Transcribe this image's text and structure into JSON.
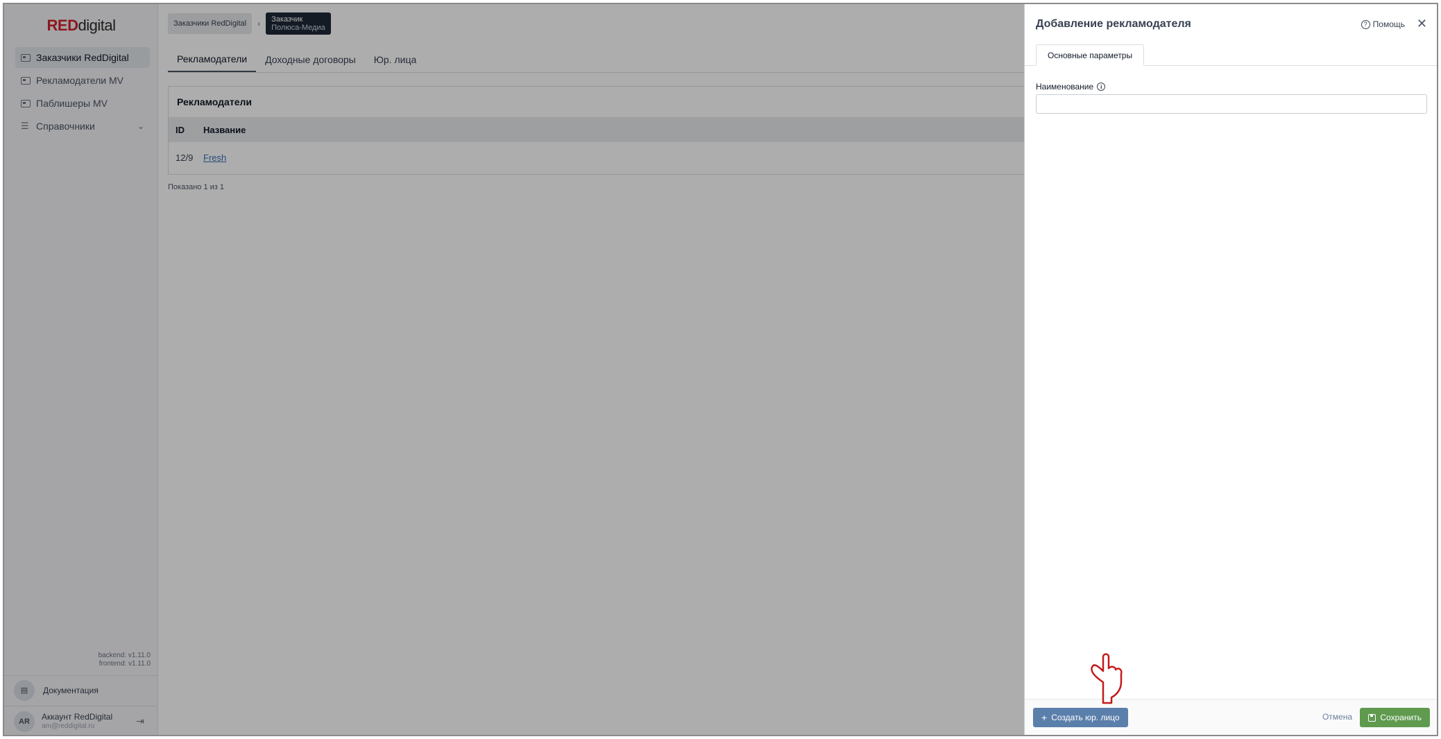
{
  "logo": {
    "red": "RED",
    "rest": "digital"
  },
  "sidebar": {
    "items": [
      {
        "label": "Заказчики RedDigital",
        "icon": "card-icon",
        "active": true
      },
      {
        "label": "Рекламодатели MV",
        "icon": "card-icon",
        "active": false
      },
      {
        "label": "Паблишеры MV",
        "icon": "card-icon",
        "active": false
      },
      {
        "label": "Справочники",
        "icon": "list-icon",
        "active": false
      }
    ],
    "versions": {
      "backend": "backend: v1.11.0",
      "frontend": "frontend: v1.11.0"
    },
    "docs_label": "Документация",
    "account": {
      "initials": "AR",
      "name": "Аккаунт RedDigital",
      "email": "am@reddigital.ru"
    }
  },
  "breadcrumbs": {
    "first": "Заказчики RedDigital",
    "current_title": "Заказчик",
    "current_sub": "Полюса-Медиа"
  },
  "tabs": [
    "Рекламодатели",
    "Доходные договоры",
    "Юр. лица"
  ],
  "table": {
    "title": "Рекламодатели",
    "columns": [
      "ID",
      "Название"
    ],
    "rows": [
      {
        "id": "12/9",
        "name": "Fresh"
      }
    ],
    "shown": "Показано 1 из 1"
  },
  "drawer": {
    "title": "Добавление рекламодателя",
    "help": "Помощь",
    "tab": "Основные параметры",
    "field_label": "Наименование",
    "field_value": "",
    "create_label": "Создать юр. лицо",
    "cancel_label": "Отмена",
    "save_label": "Сохранить"
  },
  "colors": {
    "brand_red": "#d1212b",
    "primary": "#5b7fab",
    "success": "#5f9a4f",
    "link": "#3b6fb6"
  }
}
